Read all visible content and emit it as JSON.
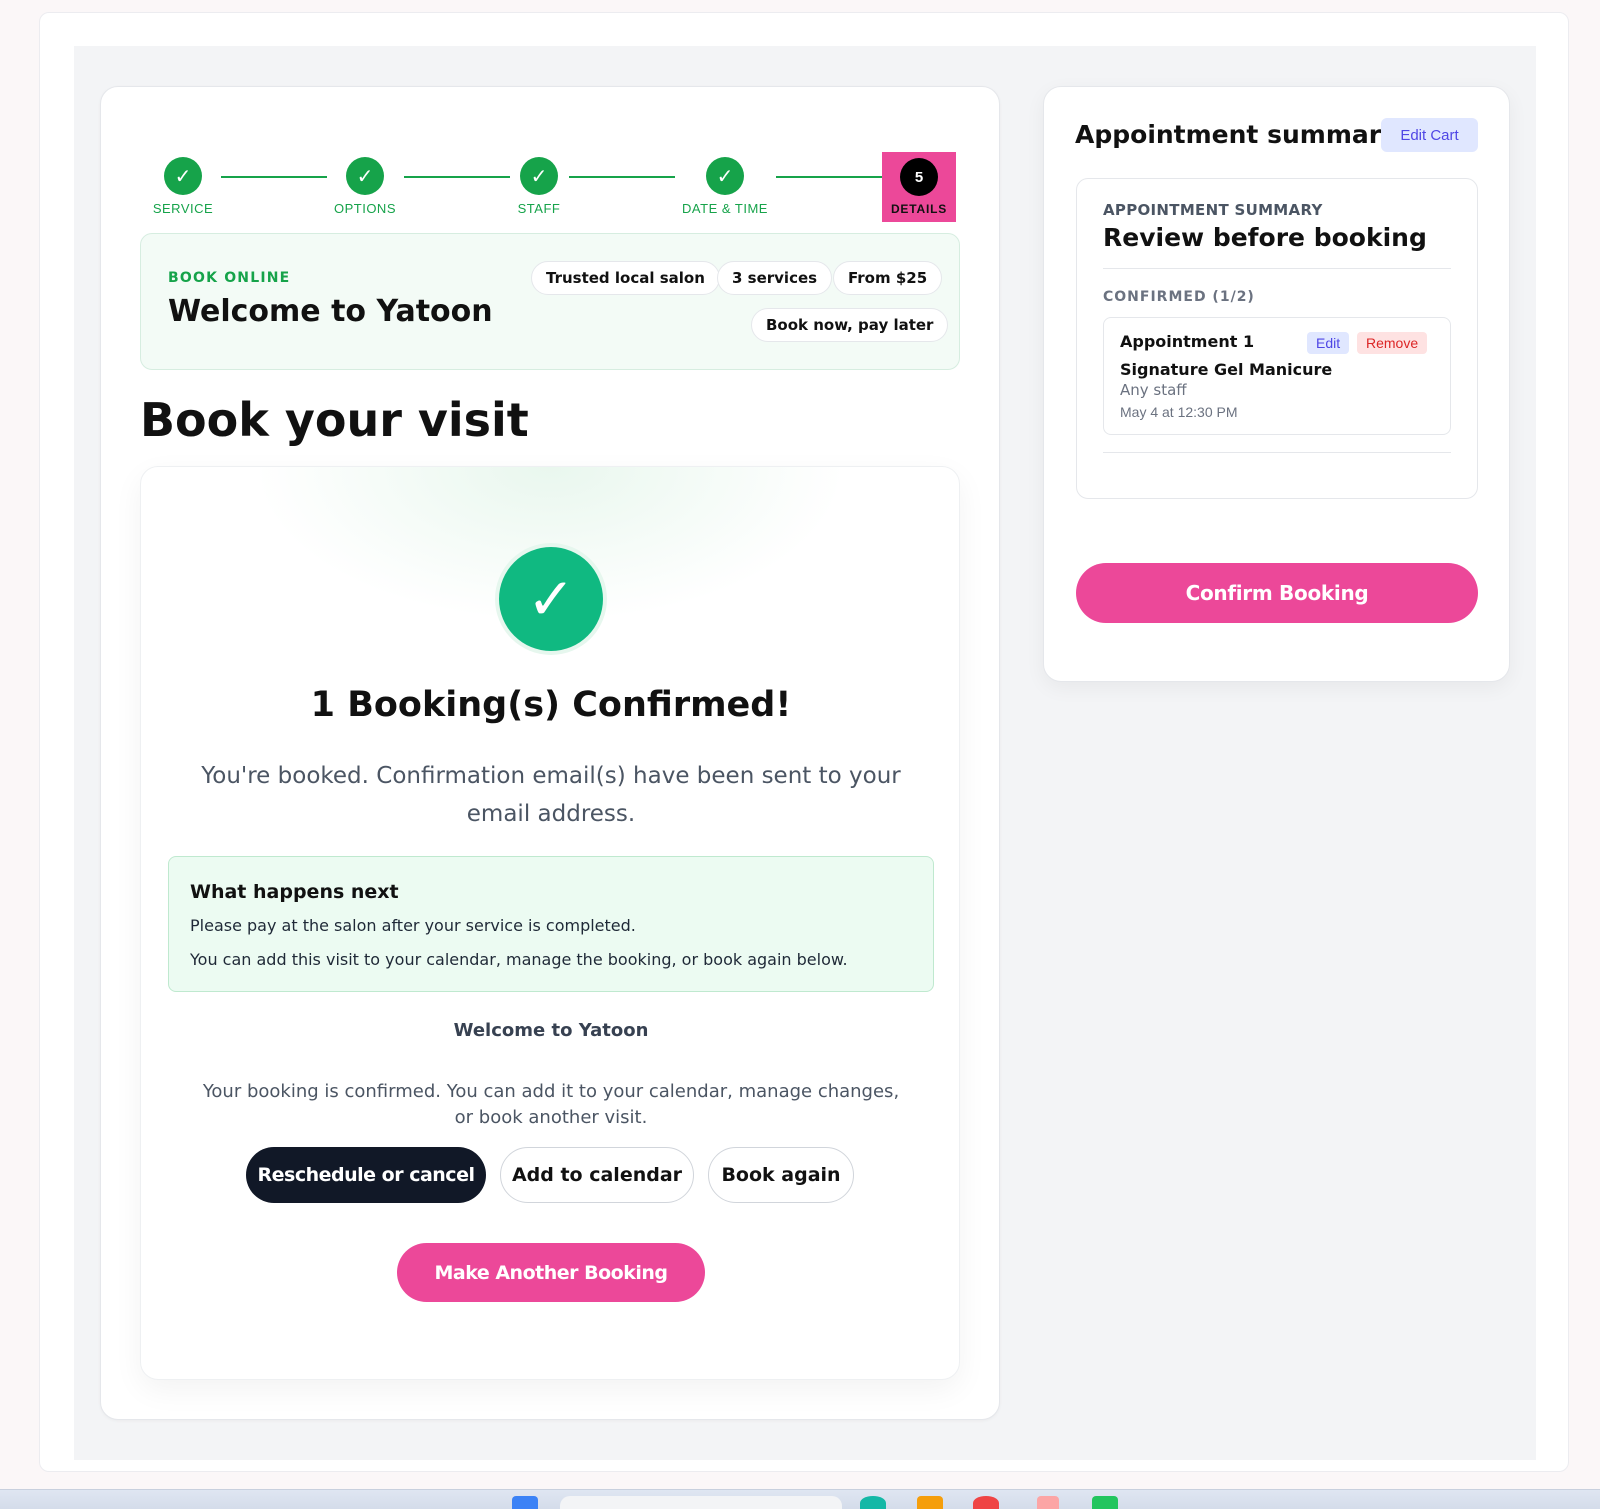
{
  "stepper": {
    "steps": [
      {
        "label": "SERVICE",
        "icon": "check-icon"
      },
      {
        "label": "OPTIONS",
        "icon": "check-icon"
      },
      {
        "label": "STAFF",
        "icon": "check-icon"
      },
      {
        "label": "DATE & TIME",
        "icon": "check-icon"
      }
    ],
    "active": {
      "number": "5",
      "label": "DETAILS"
    },
    "check_glyph": "✓",
    "colors": {
      "done": "#16a34a",
      "active_bg": "#ec4899"
    }
  },
  "banner": {
    "eyebrow": "BOOK ONLINE",
    "title": "Welcome to Yatoon",
    "pills": [
      "Trusted local salon",
      "3 services",
      "From $25",
      "Book now, pay later"
    ]
  },
  "page_title": "Book your visit",
  "confirmation": {
    "check_glyph": "✓",
    "title": "1 Booking(s) Confirmed!",
    "subtitle": "You're booked. Confirmation email(s) have been sent to your email address.",
    "next": {
      "heading": "What happens next",
      "line1": "Please pay at the salon after your service is completed.",
      "line2": "You can add this visit to your calendar, manage the booking, or book again below."
    },
    "welcome": "Welcome to Yatoon",
    "description": "Your booking is confirmed. You can add it to your calendar, manage changes, or book another visit.",
    "buttons": {
      "reschedule": "Reschedule or cancel",
      "calendar": "Add to calendar",
      "again": "Book again",
      "another": "Make Another Booking"
    }
  },
  "summary": {
    "heading": "Appointment summary",
    "edit_cart": "Edit Cart",
    "eyebrow": "APPOINTMENT SUMMARY",
    "title": "Review before booking",
    "confirmed_label": "CONFIRMED (1/2)",
    "appointment": {
      "title": "Appointment 1",
      "edit": "Edit",
      "remove": "Remove",
      "service": "Signature Gel Manicure",
      "staff": "Any staff",
      "time": "May 4 at 12:30 PM"
    },
    "confirm_button": "Confirm Booking"
  },
  "colors": {
    "accent": "#ec4899",
    "success": "#10b981",
    "dark": "#111827"
  }
}
